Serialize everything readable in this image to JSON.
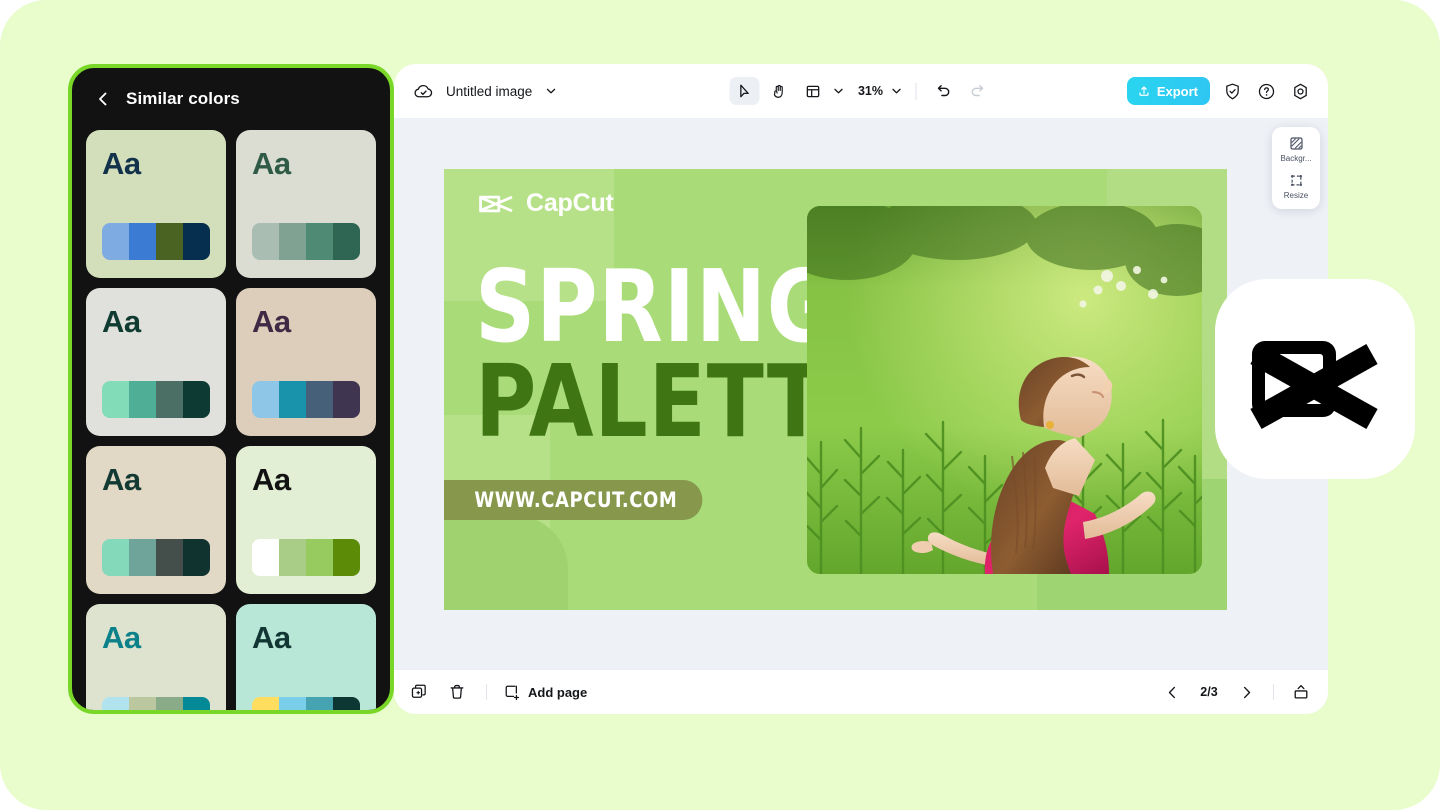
{
  "theme": {
    "page_bg": "#e8fccc",
    "panel_bg": "#121212",
    "panel_border": "#79d728",
    "accent": "#2ad5ef",
    "editor_bg": "#eef1f6"
  },
  "panel": {
    "title": "Similar colors",
    "back_icon": "chevron-left-icon",
    "sample_text": "Aa",
    "cards": [
      {
        "bg": "#d3debb",
        "text_color": "#11324a",
        "swatches": [
          "#7fabe3",
          "#3b7bd4",
          "#4a6322",
          "#062f4f"
        ]
      },
      {
        "bg": "#dbddd3",
        "text_color": "#2f5a46",
        "swatches": [
          "#a9bdb2",
          "#80a292",
          "#4e8a74",
          "#2f6653"
        ]
      },
      {
        "bg": "#e0e0dc",
        "text_color": "#0f3b31",
        "swatches": [
          "#83dcb8",
          "#4fae96",
          "#4b6f64",
          "#0d3a32"
        ]
      },
      {
        "bg": "#ddcebb",
        "text_color": "#3e2a44",
        "swatches": [
          "#8dc6e6",
          "#1993ac",
          "#46607a",
          "#3f3550"
        ]
      },
      {
        "bg": "#e2d8c6",
        "text_color": "#123a33",
        "swatches": [
          "#84d9bb",
          "#6ea49a",
          "#444f4c",
          "#10332f"
        ]
      },
      {
        "bg": "#e3efd4",
        "text_color": "#121212",
        "swatches": [
          "#ffffff",
          "#a9cc87",
          "#98cb5f",
          "#5c8b08"
        ]
      },
      {
        "bg": "#dde3cf",
        "text_color": "#0d8189",
        "swatches": [
          "#b1e3ee",
          "#bbc79e",
          "#89ab87",
          "#038a96"
        ]
      },
      {
        "bg": "#b9e7d7",
        "text_color": "#123633",
        "swatches": [
          "#ffdd5e",
          "#79cfe9",
          "#45a3b2",
          "#0c3733"
        ]
      }
    ]
  },
  "toolbar": {
    "cloud_icon": "cloud-check-icon",
    "doc_title": "Untitled image",
    "title_chevron": "chevron-down-icon",
    "tools": [
      {
        "name": "select-tool",
        "icon": "cursor-arrow-icon",
        "active": true
      },
      {
        "name": "hand-tool",
        "icon": "hand-icon",
        "active": false
      },
      {
        "name": "layout-tool",
        "icon": "layout-icon",
        "active": false
      }
    ],
    "layout_chevron": "chevron-down-icon",
    "zoom_value": "31%",
    "zoom_chevron": "chevron-down-icon",
    "undo_icon": "undo-icon",
    "redo_icon": "redo-icon",
    "export_label": "Export",
    "export_icon": "upload-icon",
    "right_icons": [
      {
        "name": "shield-check-icon"
      },
      {
        "name": "help-circle-icon"
      },
      {
        "name": "settings-gear-icon"
      }
    ]
  },
  "float_panel": {
    "items": [
      {
        "name": "background-tool",
        "icon": "background-swatch-icon",
        "label": "Backgr..."
      },
      {
        "name": "resize-tool",
        "icon": "resize-icon",
        "label": "Resize"
      }
    ]
  },
  "design": {
    "brand": "CapCut",
    "brand_logo_icon": "capcut-logo-icon",
    "headline_line1": "SPRING",
    "headline_line2": "PALETTE",
    "url_label": "WWW.CAPCUT.COM",
    "photo_alt": "woman-in-green-field-photo",
    "colors": {
      "base": "#a9dc78",
      "light_block": "#b6e188",
      "headline1_color": "#ffffff",
      "headline2_color": "#3f7513",
      "url_pill_bg": "#87984d"
    }
  },
  "bottombar": {
    "duplicate_icon": "duplicate-page-icon",
    "delete_icon": "trash-icon",
    "add_page_icon": "add-page-icon",
    "add_page_label": "Add page",
    "prev_icon": "chevron-left-icon",
    "page_indicator": "2/3",
    "next_icon": "chevron-right-icon",
    "expand_icon": "expand-up-icon"
  },
  "badge": {
    "icon": "capcut-logo-icon"
  }
}
